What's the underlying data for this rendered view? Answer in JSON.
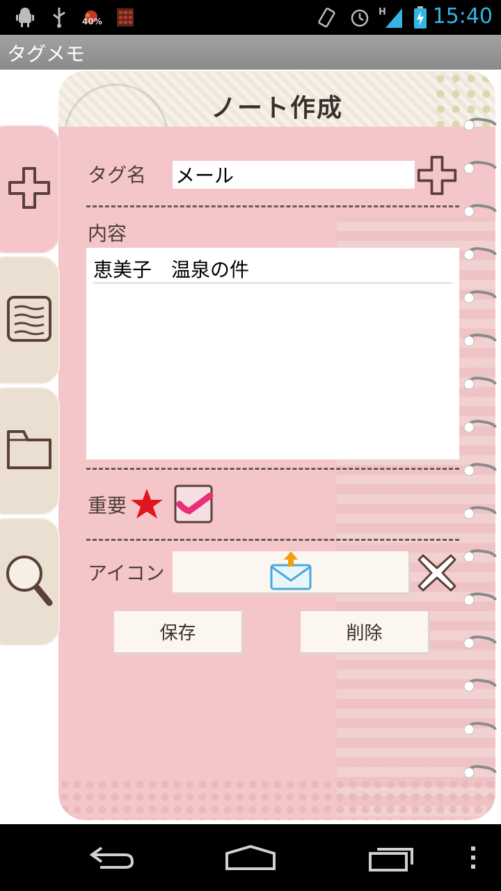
{
  "status_bar": {
    "icons": [
      "android-debug-icon",
      "usb-icon",
      "battery-widget-icon",
      "calculator-icon",
      "vibrate-icon",
      "alarm-icon",
      "signal-icon",
      "battery-charging-icon"
    ],
    "battery_widget_text": "40%",
    "network_type": "H",
    "time": "15:40",
    "accent_color": "#33b5e5"
  },
  "app": {
    "title": "タグメモ"
  },
  "note": {
    "header": "ノート作成",
    "tag_label": "タグ名",
    "tag_value": "メール",
    "content_label": "内容",
    "content_value": "恵美子　温泉の件",
    "important_label": "重要",
    "important_checked": true,
    "icon_label": "アイコン",
    "icon_name": "envelope-upload-icon",
    "save_label": "保存",
    "delete_label": "削除"
  },
  "side_tabs": [
    {
      "name": "add",
      "icon": "plus-icon",
      "active": true
    },
    {
      "name": "list",
      "icon": "notepad-icon",
      "active": false
    },
    {
      "name": "folder",
      "icon": "folder-icon",
      "active": false
    },
    {
      "name": "search",
      "icon": "magnifier-icon",
      "active": false
    }
  ],
  "nav_bar": {
    "icons": [
      "back-icon",
      "home-icon",
      "recent-apps-icon",
      "menu-icon"
    ]
  },
  "colors": {
    "notebook_pink": "#f5c6c9",
    "star_red": "#e0161e",
    "check_magenta": "#e8307a"
  }
}
